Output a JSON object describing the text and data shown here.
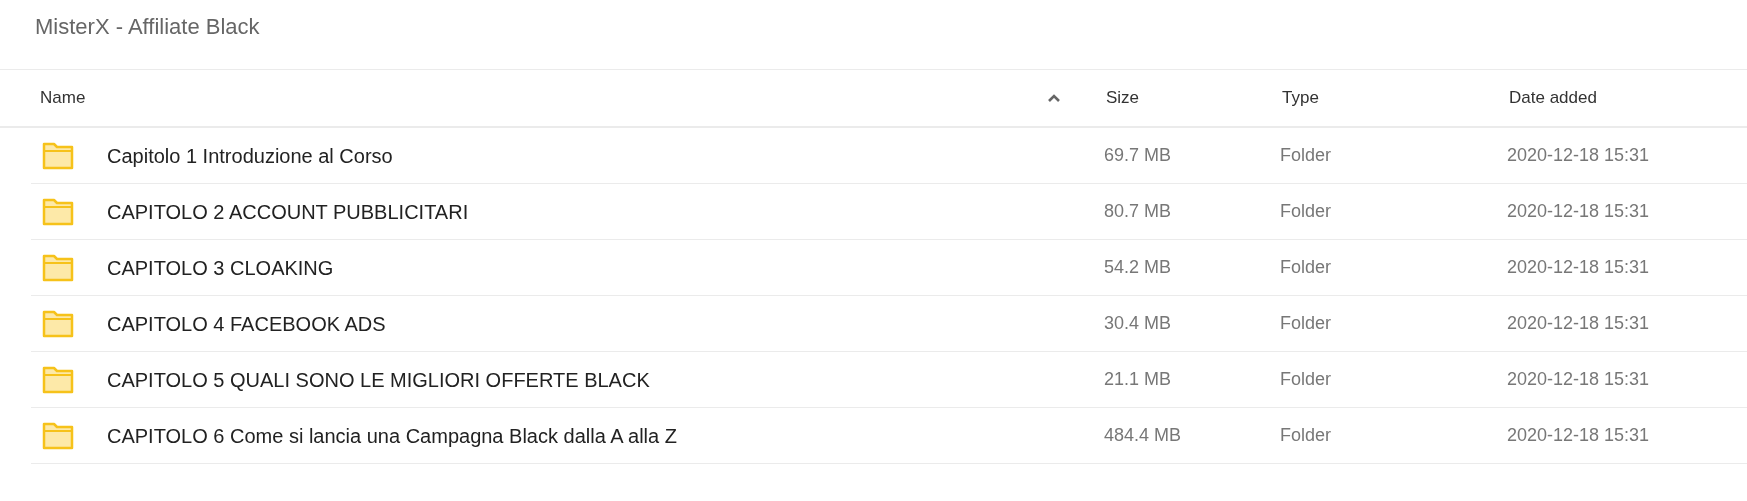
{
  "title": "MisterX - Affiliate Black",
  "table": {
    "columns": [
      {
        "label": "Name",
        "sorted": true,
        "ascending": true
      },
      {
        "label": "Size"
      },
      {
        "label": "Type"
      },
      {
        "label": "Date added"
      }
    ],
    "rows": [
      {
        "kind": "folder",
        "name": "Capitolo 1 Introduzione al Corso",
        "size": "69.7 MB",
        "type": "Folder",
        "date": "2020-12-18 15:31"
      },
      {
        "kind": "folder",
        "name": "CAPITOLO 2 ACCOUNT PUBBLICITARI",
        "size": "80.7 MB",
        "type": "Folder",
        "date": "2020-12-18 15:31"
      },
      {
        "kind": "folder",
        "name": "CAPITOLO 3 CLOAKING",
        "size": "54.2 MB",
        "type": "Folder",
        "date": "2020-12-18 15:31"
      },
      {
        "kind": "folder",
        "name": "CAPITOLO 4 FACEBOOK ADS",
        "size": "30.4 MB",
        "type": "Folder",
        "date": "2020-12-18 15:31"
      },
      {
        "kind": "folder",
        "name": "CAPITOLO 5 QUALI SONO LE MIGLIORI OFFERTE BLACK",
        "size": "21.1 MB",
        "type": "Folder",
        "date": "2020-12-18 15:31"
      },
      {
        "kind": "folder",
        "name": "CAPITOLO 6 Come si lancia una Campagna Black dalla A alla Z",
        "size": "484.4 MB",
        "type": "Folder",
        "date": "2020-12-18 15:31"
      }
    ]
  }
}
